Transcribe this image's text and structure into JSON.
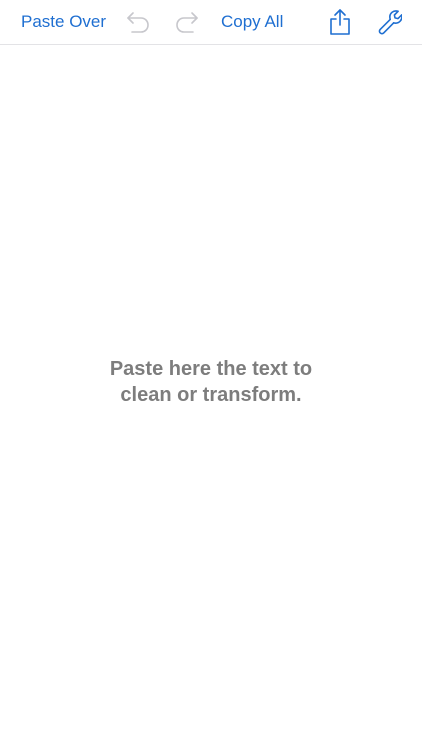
{
  "toolbar": {
    "paste_over_label": "Paste Over",
    "copy_all_label": "Copy All",
    "icons": {
      "undo": "undo-arrow-icon",
      "redo": "redo-arrow-icon",
      "share": "share-icon",
      "settings": "wrench-icon"
    },
    "colors": {
      "accent": "#1f6fd1",
      "disabled": "#c7c7cc"
    }
  },
  "editor": {
    "placeholder_line1": "Paste here the text to",
    "placeholder_line2": "clean or transform.",
    "placeholder_color": "#7d7d7d"
  }
}
